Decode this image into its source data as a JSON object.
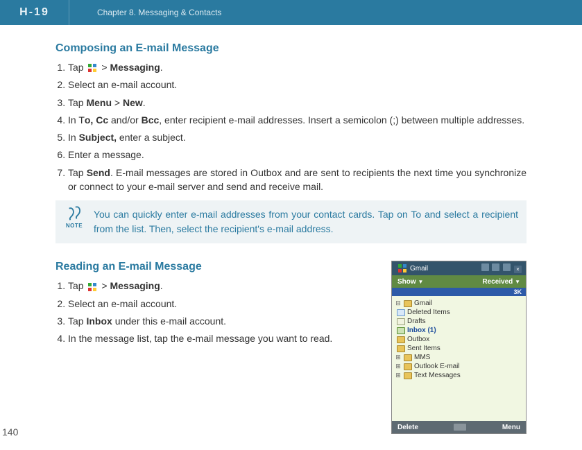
{
  "header": {
    "brand": "H-19",
    "chapter": "Chapter 8. Messaging & Contacts"
  },
  "section1": {
    "title": "Composing an E-mail Message",
    "step1_pre": "Tap ",
    "step1_post": " > ",
    "step1_bold": "Messaging",
    "step1_end": ".",
    "step2": "Select an e-mail account.",
    "step3_pre": "Tap ",
    "step3_b1": "Menu",
    "step3_mid": " > ",
    "step3_b2": "New",
    "step3_end": ".",
    "step4_pre": "In T",
    "step4_b1": "o, Cc",
    "step4_mid": " and/or ",
    "step4_b2": "Bcc",
    "step4_post": ", enter recipient e-mail addresses. Insert a semicolon (;) between multiple addresses.",
    "step5_pre": "In ",
    "step5_b": "Subject,",
    "step5_post": " enter a subject.",
    "step6": "Enter a message.",
    "step7_pre": "Tap ",
    "step7_b": "Send",
    "step7_post": ". E-mail messages are stored in Outbox and are sent to recipients the next time you synchronize or connect to your e-mail server and send and receive mail."
  },
  "note": {
    "label": "NOTE",
    "text": "You can quickly enter e-mail addresses from your contact cards. Tap on To and select a recipient from the list. Then, select the recipient's e-mail address."
  },
  "section2": {
    "title": "Reading an E-mail Message",
    "step1_pre": "Tap ",
    "step1_post": " > ",
    "step1_bold": "Messaging",
    "step1_end": ".",
    "step2": "Select an e-mail account.",
    "step3_pre": "Tap ",
    "step3_b": "Inbox",
    "step3_post": " under this e-mail account.",
    "step4": "In the message list, tap the e-mail message you want to read."
  },
  "screenshot": {
    "title": "Gmail",
    "sort_left": "Show",
    "sort_right": "Received",
    "badge": "3K",
    "tree": {
      "root": "Gmail",
      "items": [
        "Deleted Items",
        "Drafts",
        "Inbox (1)",
        "Outbox",
        "Sent Items"
      ],
      "siblings": [
        "MMS",
        "Outlook E-mail",
        "Text Messages"
      ]
    },
    "btn_left": "Delete",
    "btn_right": "Menu"
  },
  "page_number": "140"
}
